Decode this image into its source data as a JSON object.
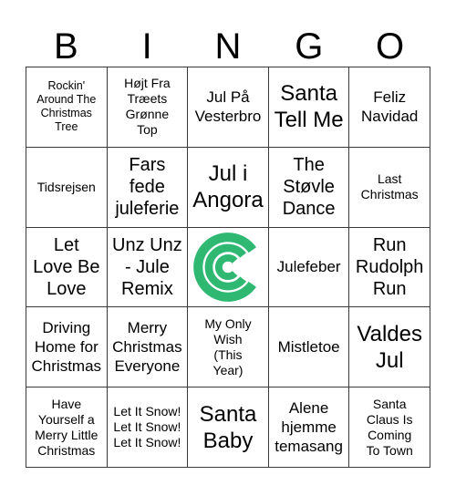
{
  "card": {
    "header_letters": [
      "B",
      "I",
      "N",
      "G",
      "O"
    ],
    "accent_color": "#2EB872",
    "border_color": "#3A3A3A",
    "background_color": "#FFFFFF",
    "columns": 5,
    "rows": 5
  },
  "free_space": {
    "position": "row3-col3",
    "icon_name": "concentric-c-logo",
    "color": "#2EB872",
    "label": ""
  },
  "cells": [
    {
      "row": 1,
      "col": 1,
      "column_letter": "B",
      "text": "Rockin'\nAround The\nChristmas\nTree",
      "size": "fs-xs",
      "free": false
    },
    {
      "row": 1,
      "col": 2,
      "column_letter": "I",
      "text": "Højt Fra\nTræets\nGrønne\nTop",
      "size": "fs-s",
      "free": false
    },
    {
      "row": 1,
      "col": 3,
      "column_letter": "N",
      "text": "Jul På\nVesterbro",
      "size": "fs-m",
      "free": false
    },
    {
      "row": 1,
      "col": 4,
      "column_letter": "G",
      "text": "Santa\nTell Me",
      "size": "fs-xl",
      "free": false
    },
    {
      "row": 1,
      "col": 5,
      "column_letter": "O",
      "text": "Feliz\nNavidad",
      "size": "fs-m",
      "free": false
    },
    {
      "row": 2,
      "col": 1,
      "column_letter": "B",
      "text": "Tidsrejsen",
      "size": "fs-s",
      "free": false
    },
    {
      "row": 2,
      "col": 2,
      "column_letter": "I",
      "text": "Fars\nfede\njuleferie",
      "size": "fs-l",
      "free": false
    },
    {
      "row": 2,
      "col": 3,
      "column_letter": "N",
      "text": "Jul i\nAngora",
      "size": "fs-xl",
      "free": false
    },
    {
      "row": 2,
      "col": 4,
      "column_letter": "G",
      "text": "The\nStøvle\nDance",
      "size": "fs-l",
      "free": false
    },
    {
      "row": 2,
      "col": 5,
      "column_letter": "O",
      "text": "Last\nChristmas",
      "size": "fs-s",
      "free": false
    },
    {
      "row": 3,
      "col": 1,
      "column_letter": "B",
      "text": "Let\nLove Be\nLove",
      "size": "fs-l",
      "free": false
    },
    {
      "row": 3,
      "col": 2,
      "column_letter": "I",
      "text": "Unz Unz\n- Jule\nRemix",
      "size": "fs-l",
      "free": false
    },
    {
      "row": 3,
      "col": 3,
      "column_letter": "N",
      "text": "",
      "size": "fs-m",
      "free": true
    },
    {
      "row": 3,
      "col": 4,
      "column_letter": "G",
      "text": "Julefeber",
      "size": "fs-m",
      "free": false
    },
    {
      "row": 3,
      "col": 5,
      "column_letter": "O",
      "text": "Run\nRudolph\nRun",
      "size": "fs-l",
      "free": false
    },
    {
      "row": 4,
      "col": 1,
      "column_letter": "B",
      "text": "Driving\nHome for\nChristmas",
      "size": "fs-m",
      "free": false
    },
    {
      "row": 4,
      "col": 2,
      "column_letter": "I",
      "text": "Merry\nChristmas\nEveryone",
      "size": "fs-m",
      "free": false
    },
    {
      "row": 4,
      "col": 3,
      "column_letter": "N",
      "text": "My Only\nWish\n(This\nYear)",
      "size": "fs-s",
      "free": false
    },
    {
      "row": 4,
      "col": 4,
      "column_letter": "G",
      "text": "Mistletoe",
      "size": "fs-m",
      "free": false
    },
    {
      "row": 4,
      "col": 5,
      "column_letter": "O",
      "text": "Valdes\nJul",
      "size": "fs-xl",
      "free": false
    },
    {
      "row": 5,
      "col": 1,
      "column_letter": "B",
      "text": "Have\nYourself a\nMerry Little\nChristmas",
      "size": "fs-s",
      "free": false
    },
    {
      "row": 5,
      "col": 2,
      "column_letter": "I",
      "text": "Let It Snow!\nLet It Snow!\nLet It Snow!",
      "size": "fs-s",
      "free": false
    },
    {
      "row": 5,
      "col": 3,
      "column_letter": "N",
      "text": "Santa\nBaby",
      "size": "fs-xl",
      "free": false
    },
    {
      "row": 5,
      "col": 4,
      "column_letter": "G",
      "text": "Alene\nhjemme\ntemasang",
      "size": "fs-m",
      "free": false
    },
    {
      "row": 5,
      "col": 5,
      "column_letter": "O",
      "text": "Santa\nClaus Is\nComing\nTo Town",
      "size": "fs-s",
      "free": false
    }
  ]
}
